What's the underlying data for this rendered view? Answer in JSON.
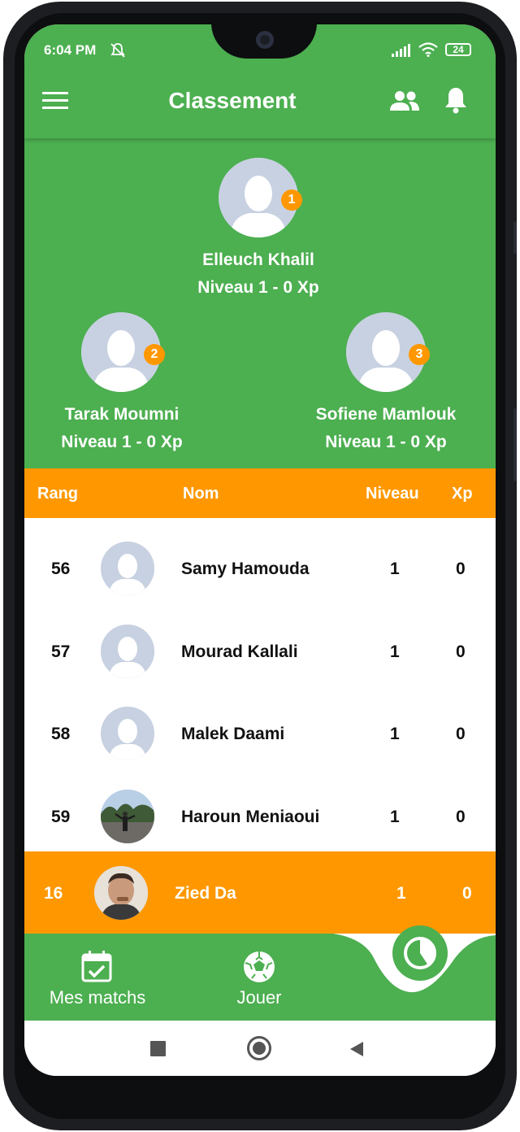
{
  "status_bar": {
    "time": "6:04 PM",
    "battery": "24"
  },
  "app_bar": {
    "title": "Classement"
  },
  "podium": [
    {
      "rank": "1",
      "name": "Elleuch Khalil",
      "level": "Niveau 1 - 0 Xp"
    },
    {
      "rank": "2",
      "name": "Tarak Moumni",
      "level": "Niveau 1 - 0 Xp"
    },
    {
      "rank": "3",
      "name": "Sofiene Mamlouk",
      "level": "Niveau 1 - 0 Xp"
    }
  ],
  "table_header": {
    "rank": "Rang",
    "name": "Nom",
    "level": "Niveau",
    "xp": "Xp"
  },
  "rows": [
    {
      "rank": "56",
      "name": "Samy Hamouda",
      "level": "1",
      "xp": "0"
    },
    {
      "rank": "57",
      "name": "Mourad Kallali",
      "level": "1",
      "xp": "0"
    },
    {
      "rank": "58",
      "name": "Malek Daami",
      "level": "1",
      "xp": "0"
    },
    {
      "rank": "59",
      "name": "Haroun Meniaoui",
      "level": "1",
      "xp": "0"
    }
  ],
  "current_user": {
    "rank": "16",
    "name": "Zied Da",
    "level": "1",
    "xp": "0"
  },
  "bottom_nav": {
    "matches": "Mes matchs",
    "play": "Jouer"
  },
  "colors": {
    "primary": "#4caf50",
    "accent": "#ff9800"
  },
  "icons": [
    "menu-icon",
    "group-icon",
    "bell-icon",
    "calendar-check-icon",
    "soccer-ball-icon",
    "pie-chart-icon"
  ]
}
